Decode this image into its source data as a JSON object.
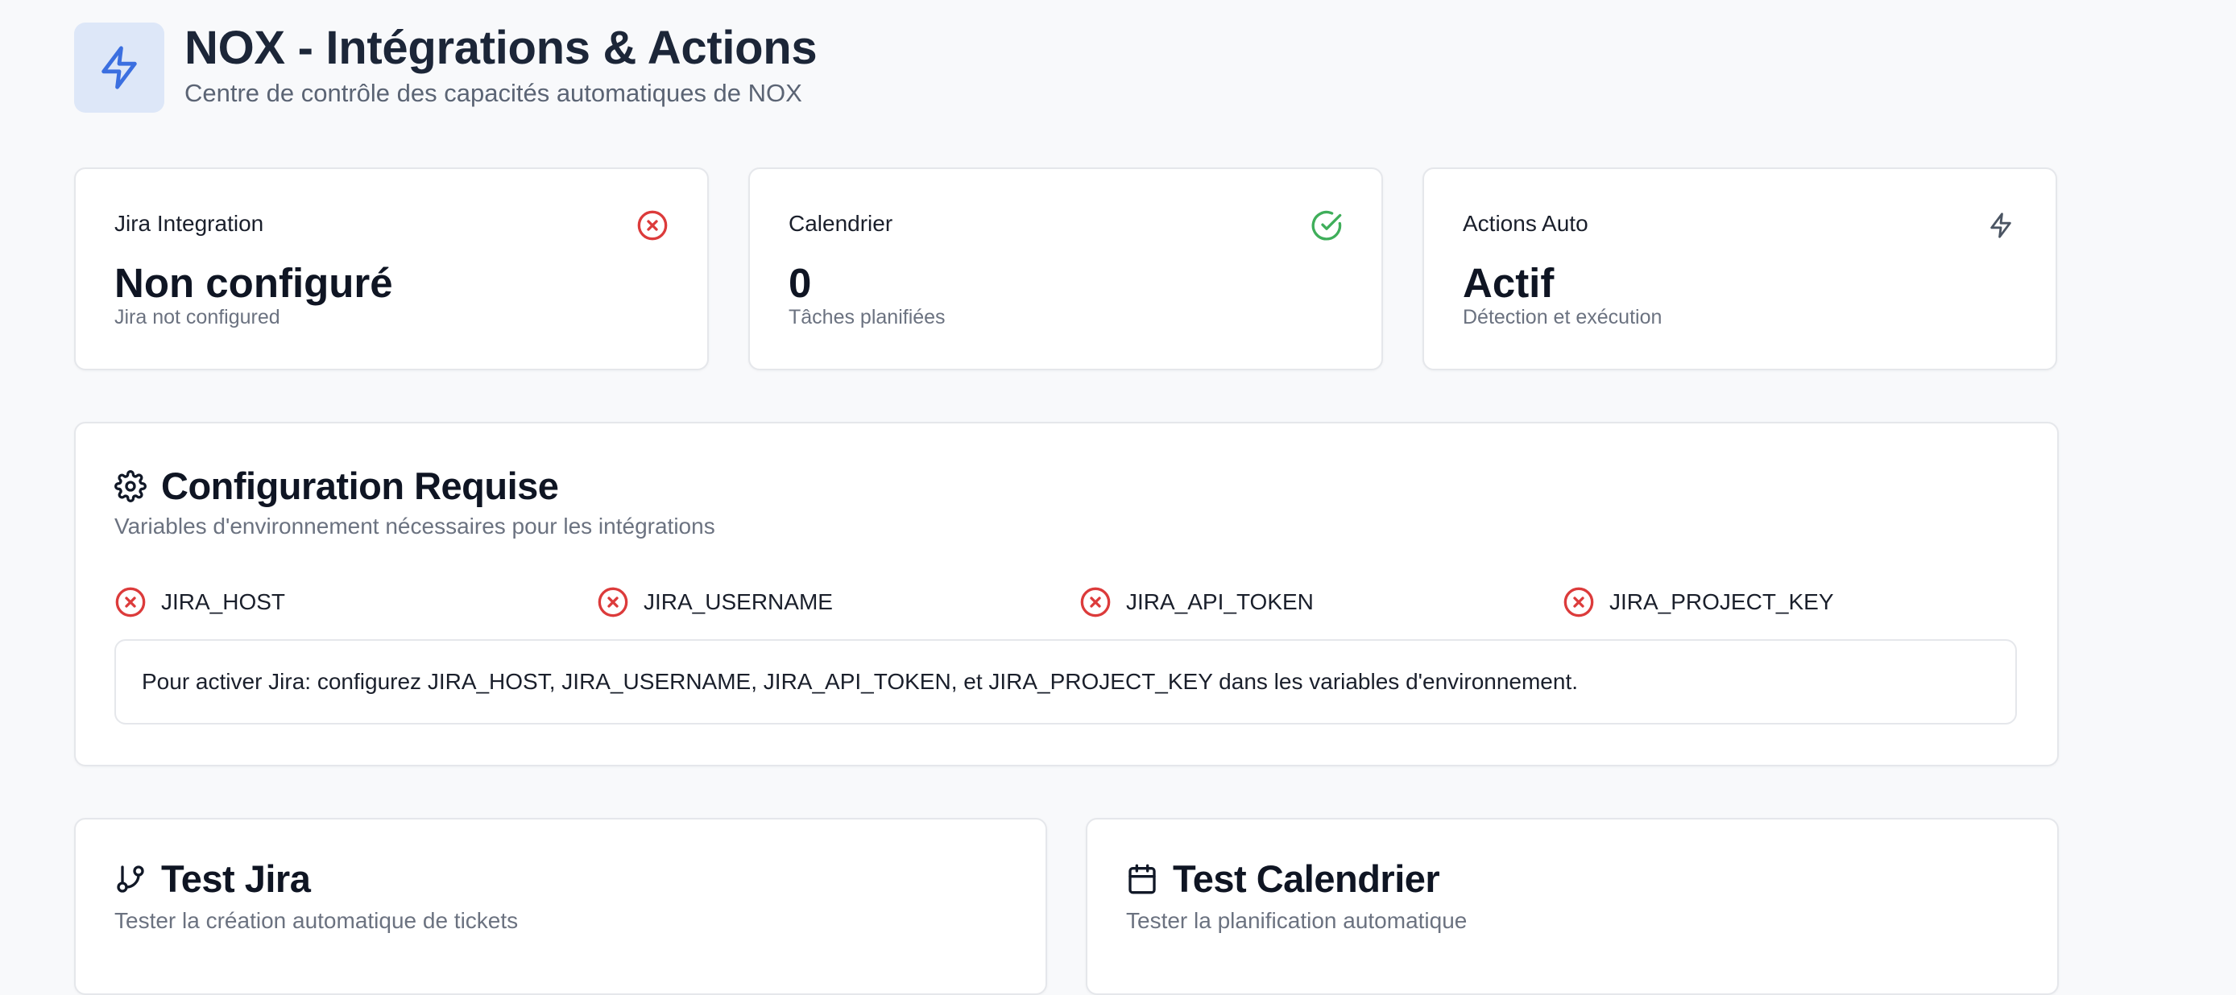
{
  "header": {
    "title": "NOX - Intégrations & Actions",
    "subtitle": "Centre de contrôle des capacités automatiques de NOX",
    "logo_icon": "lightning-icon"
  },
  "stats": [
    {
      "label": "Jira Integration",
      "value": "Non configuré",
      "sub": "Jira not configured",
      "icon": "x-circle-icon",
      "icon_color": "#dc3b3b"
    },
    {
      "label": "Calendrier",
      "value": "0",
      "sub": "Tâches planifiées",
      "icon": "check-circle-icon",
      "icon_color": "#3fae5a"
    },
    {
      "label": "Actions Auto",
      "value": "Actif",
      "sub": "Détection et exécution",
      "icon": "lightning-icon",
      "icon_color": "#4b5563"
    }
  ],
  "config": {
    "title": "Configuration Requise",
    "description": "Variables d'environnement nécessaires pour les intégrations",
    "vars": [
      {
        "name": "JIRA_HOST",
        "status": "missing"
      },
      {
        "name": "JIRA_USERNAME",
        "status": "missing"
      },
      {
        "name": "JIRA_API_TOKEN",
        "status": "missing"
      },
      {
        "name": "JIRA_PROJECT_KEY",
        "status": "missing"
      }
    ],
    "info": "Pour activer Jira: configurez JIRA_HOST, JIRA_USERNAME, JIRA_API_TOKEN, et JIRA_PROJECT_KEY dans les variables d'environnement."
  },
  "test_jira": {
    "title": "Test Jira",
    "description": "Tester la création automatique de tickets",
    "icon": "git-branch-icon"
  },
  "test_calendar": {
    "title": "Test Calendrier",
    "description": "Tester la planification automatique",
    "icon": "calendar-icon"
  },
  "colors": {
    "accent": "#3b6fe0",
    "error": "#dc3b3b",
    "success": "#3fae5a"
  }
}
